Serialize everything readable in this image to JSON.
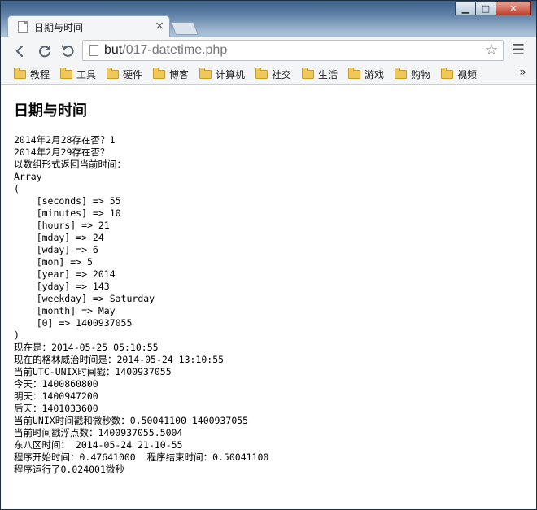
{
  "browser": {
    "tab_title": "日期与时间",
    "tab_close": "×",
    "url_host": "but",
    "url_path": "/017-datetime.php",
    "window_buttons": {
      "minimize": "▁",
      "maximize": "□",
      "close": "✕"
    }
  },
  "toolbar_icons": [
    "back-icon",
    "reload-icon",
    "undo-icon",
    "star-icon",
    "menu-icon"
  ],
  "bookmarks": [
    "教程",
    "工具",
    "硬件",
    "博客",
    "计算机",
    "社交",
    "生活",
    "游戏",
    "购物",
    "视频"
  ],
  "bookmarks_more": "»",
  "page": {
    "heading": "日期与时间",
    "lines": [
      "2014年2月28存在否？1",
      "2014年2月29存在否？",
      "以数组形式返回当前时间：",
      "Array",
      "(",
      "    [seconds] => 55",
      "    [minutes] => 10",
      "    [hours] => 21",
      "    [mday] => 24",
      "    [wday] => 6",
      "    [mon] => 5",
      "    [year] => 2014",
      "    [yday] => 143",
      "    [weekday] => Saturday",
      "    [month] => May",
      "    [0] => 1400937055",
      ")",
      "现在是：2014-05-25 05:10:55",
      "现在的格林威治时间是：2014-05-24 13:10:55",
      "当前UTC-UNIX时间戳：1400937055",
      "今天：1400860800",
      "明天：1400947200",
      "后天：1401033600",
      "当前UNIX时间戳和微秒数：0.50041100 1400937055",
      "当前时间戳浮点数：1400937055.5004",
      "东八区时间： 2014-05-24 21-10-55",
      "程序开始时间：0.47641000  程序结束时间：0.50041100",
      "程序运行了0.024001微秒"
    ]
  }
}
